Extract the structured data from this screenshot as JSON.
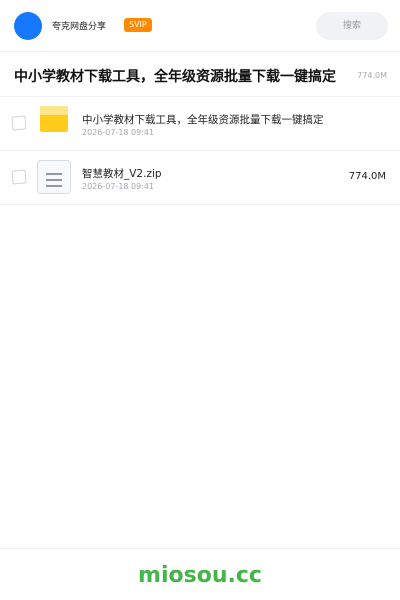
{
  "header": {
    "brand": "夸克网盘分享",
    "badge": "SVIP",
    "search_placeholder": "搜索"
  },
  "page": {
    "title": "中小学教材下载工具，全年级资源批量下载一键搞定",
    "title_size": "774.0M"
  },
  "files": [
    {
      "name": "中小学教材下载工具，全年级资源批量下载一键搞定",
      "date": "2026-07-18 09:41",
      "type": "folder",
      "icon": "folder-icon"
    },
    {
      "name": "智慧教材_V2.zip",
      "date": "2026-07-18 09:41",
      "size": "774.0M",
      "type": "file",
      "icon": "zip-file-icon"
    }
  ],
  "footer": {
    "site": "miosou.cc"
  },
  "colors": {
    "primary": "#1677ff",
    "svip": "#ff8a00",
    "folder": "#ffcc1a",
    "site": "#44b549"
  }
}
